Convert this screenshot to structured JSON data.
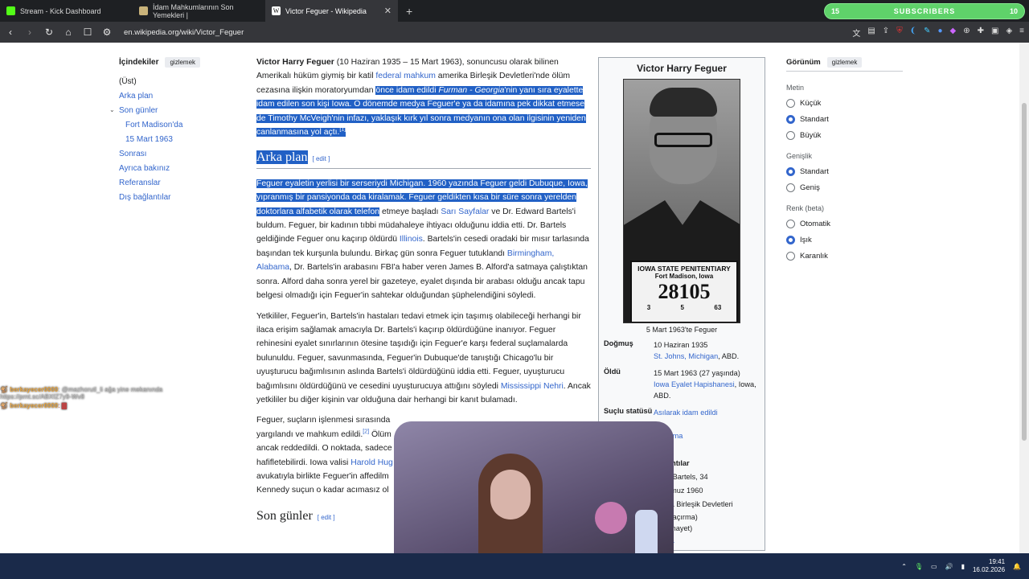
{
  "tabs": [
    {
      "label": "Stream - Kick Dashboard",
      "color": "#53fc18"
    },
    {
      "label": "İdam Mahkumlarının Son Yemekleri |",
      "color": "#c9b37a"
    },
    {
      "label": "Victor Feguer - Wikipedia",
      "color": "#ffffff"
    }
  ],
  "subscribers": {
    "left": "15",
    "label": "SUBSCRIBERS",
    "right": "10"
  },
  "url": "en.wikipedia.org/wiki/Victor_Feguer",
  "toc": {
    "title": "İçindekiler",
    "hide": "gizlemek",
    "items": [
      {
        "label": "(Üst)",
        "current": true,
        "sub": false
      },
      {
        "label": "Arka plan",
        "current": false,
        "sub": false
      },
      {
        "label": "Son günler",
        "current": false,
        "sub": false,
        "caret": true
      },
      {
        "label": "Fort Madison'da",
        "current": false,
        "sub": true
      },
      {
        "label": "15 Mart 1963",
        "current": false,
        "sub": true
      },
      {
        "label": "Sonrası",
        "current": false,
        "sub": false
      },
      {
        "label": "Ayrıca bakınız",
        "current": false,
        "sub": false
      },
      {
        "label": "Referanslar",
        "current": false,
        "sub": false
      },
      {
        "label": "Dış bağlantılar",
        "current": false,
        "sub": false
      }
    ]
  },
  "article": {
    "name": "Victor Harry Feguer",
    "p1_a": " (10 Haziran 1935 – 15 Mart 1963), sonuncusu olarak bilinen Amerikalı hüküm giymiş bir katil",
    "p1_link1": "federal mahkum",
    "p1_b": " amerika Birleşik Devletleri'nde ölüm cezasına ilişkin moratoryumdan ",
    "p1_hl1": "önce idam edildi ",
    "p1_hl_italic": "Furman - Georgia",
    "p1_hl2": "'nin yanı sıra eyalette idam edilen son kişi Iowa. O dönemde medya Feguer'e ya da idamına pek dikkat etmese de Timothy McVeigh'nin infazı, yaklaşık kırk yıl sonra medyanın ona olan ilgisinin yeniden canlanmasına yol açtı.",
    "p1_ref": "[1]",
    "h_arka": "Arka plan",
    "edit": "[ edit ]",
    "p2_hl": "Feguer eyaletin yerlisi bir serseriydi Michigan. 1960 yazında Feguer geldi Dubuque, Iowa, yıpranmış bir pansiyonda oda kiralamak. Feguer geldikten kısa bir süre sonra yerelden doktorlara alfabetik olarak telefon",
    "p2_a": " etmeye başladı ",
    "p2_link1": "Sarı Sayfalar",
    "p2_b": " ve Dr. Edward Bartels'i buldum. Feguer, bir kadının tıbbi müdahaleye ihtiyacı olduğunu iddia etti. Dr. Bartels geldiğinde Feguer onu kaçırıp öldürdü ",
    "p2_link2": "Illinois",
    "p2_c": ". Bartels'in cesedi oradaki bir mısır tarlasında başından tek kurşunla bulundu. Birkaç gün sonra Feguer tutuklandı ",
    "p2_link3": "Birmingham, Alabama",
    "p2_d": ", Dr. Bartels'in arabasını FBI'a haber veren James B. Alford'a satmaya çalıştıktan sonra. Alford daha sonra yerel bir gazeteye, eyalet dışında bir arabası olduğu ancak tapu belgesi olmadığı için Feguer'in sahtekar olduğundan şüphelendiğini söyledi.",
    "p3_a": "Yetkililer, Feguer'in, Bartels'in hastaları tedavi etmek için taşımış olabileceği herhangi bir ilaca erişim sağlamak amacıyla Dr. Bartels'i kaçırıp öldürdüğüne inanıyor. Feguer rehinesini eyalet sınırlarının ötesine taşıdığı için Feguer'e karşı federal suçlamalarda bulunuldu. Feguer, savunmasında, Feguer'in Dubuque'de tanıştığı Chicago'lu bir uyuşturucu bağımlısının aslında Bartels'i öldürdüğünü iddia etti. Feguer, uyuşturucu bağımlısını öldürdüğünü ve cesedini uyuşturucuya attığını söyledi ",
    "p3_link": "Mississippi Nehri",
    "p3_b": ". Ancak yetkililer bu diğer kişinin var olduğuna dair herhangi bir kanıt bulamadı.",
    "p4_a": "Feguer, suçların işlenmesi sırasında",
    "p4_b": "yargılandı ve mahkum edildi.",
    "p4_ref": "[2]",
    "p4_c": " Ölüm",
    "p4_d": "ancak reddedildi. O noktada, sadece",
    "p4_e": "hafifletebilirdi. Iowa valisi ",
    "p4_link": "Harold Hug",
    "p4_f": "avukatıyla birlikte Feguer'in affedilm",
    "p4_g": "Kennedy suçun o kadar acımasız ol",
    "h_son": "Son günler"
  },
  "infobox": {
    "title": "Victor Harry Feguer",
    "plate_l1": "IOWA STATE PENITENTIARY",
    "plate_l2": "Fort Madison, Iowa",
    "plate_num": "28105",
    "plate_l4": [
      "3",
      "5",
      "63"
    ],
    "caption": "5 Mart 1963'te Feguer",
    "born_k": "Doğmuş",
    "born_v": "10 Haziran 1935",
    "born_link": "St. Johns, Michigan",
    ",born_tail": "",
    "born_tail": ", ABD.",
    "died_k": "Öldü",
    "died_v": "15 Mart 1963 (27 yaşında)",
    "died_link": "Iowa Eyalet Hapishanesi",
    "died_tail": ", Iowa, ABD.",
    "crim_k": "Suçlu statüsü",
    "crim_v": "Asılarak idam edildi",
    "partial": [
      "rılma",
      "rıntılar",
      "d Bartels, 34",
      "nmuz 1960",
      "ka Birleşik Devletleri",
      "(kaçırma)",
      "cinayet)",
      "ca"
    ]
  },
  "gorunum": {
    "title": "Görünüm",
    "hide": "gizlemek",
    "groups": [
      {
        "label": "Metin",
        "options": [
          {
            "label": "Küçük",
            "on": false
          },
          {
            "label": "Standart",
            "on": true
          },
          {
            "label": "Büyük",
            "on": false
          }
        ]
      },
      {
        "label": "Genişlik",
        "options": [
          {
            "label": "Standart",
            "on": true
          },
          {
            "label": "Geniş",
            "on": false
          }
        ]
      },
      {
        "label": "Renk (beta)",
        "options": [
          {
            "label": "Otomatik",
            "on": false
          },
          {
            "label": "Işık",
            "on": true
          },
          {
            "label": "Karanlık",
            "on": false
          }
        ]
      }
    ]
  },
  "chat": [
    {
      "user": "berkayecer0000",
      "msg": ": @mazhorutl_li ağa yine mekanında https://prnt.sc/ABXfZ7y9-Wv8"
    },
    {
      "user": "berkayecer0000",
      "msg": ": ▇"
    }
  ],
  "clock": {
    "time": "19:41",
    "date": "16.02.2026"
  }
}
